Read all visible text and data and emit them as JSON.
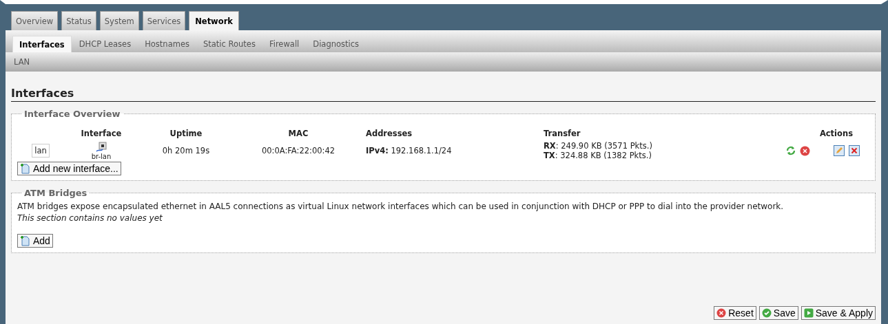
{
  "main_tabs": [
    {
      "label": "Overview",
      "selected": false
    },
    {
      "label": "Status",
      "selected": false
    },
    {
      "label": "System",
      "selected": false
    },
    {
      "label": "Services",
      "selected": false
    },
    {
      "label": "Network",
      "selected": true
    }
  ],
  "sub_tabs": [
    {
      "label": "Interfaces",
      "selected": true
    },
    {
      "label": "DHCP Leases",
      "selected": false
    },
    {
      "label": "Hostnames",
      "selected": false
    },
    {
      "label": "Static Routes",
      "selected": false
    },
    {
      "label": "Firewall",
      "selected": false
    },
    {
      "label": "Diagnostics",
      "selected": false
    }
  ],
  "third_tabs": [
    {
      "label": "LAN",
      "selected": false
    }
  ],
  "page_title": "Interfaces",
  "overview": {
    "legend": "Interface Overview",
    "columns": [
      "Interface",
      "Uptime",
      "MAC",
      "Addresses",
      "Transfer",
      "Actions"
    ],
    "rows": [
      {
        "name": "lan",
        "device": "br-lan",
        "uptime": "0h 20m 19s",
        "mac": "00:0A:FA:22:00:42",
        "address_label": "IPv4:",
        "address": "192.168.1.1/24",
        "rx_label": "RX",
        "rx": ": 249.90 KB (3571 Pkts.)",
        "tx_label": "TX",
        "tx": ": 324.88 KB (1382 Pkts.)"
      }
    ],
    "add_button": "Add new interface..."
  },
  "atm": {
    "legend": "ATM Bridges",
    "description": "ATM bridges expose encapsulated ethernet in AAL5 connections as virtual Linux network interfaces which can be used in conjunction with DHCP or PPP to dial into the provider network.",
    "empty_note": "This section contains no values yet",
    "add_button": "Add"
  },
  "footer_buttons": [
    {
      "label": "Reset",
      "kind": "reset"
    },
    {
      "label": "Save",
      "kind": "save"
    },
    {
      "label": "Save & Apply",
      "kind": "apply"
    }
  ]
}
